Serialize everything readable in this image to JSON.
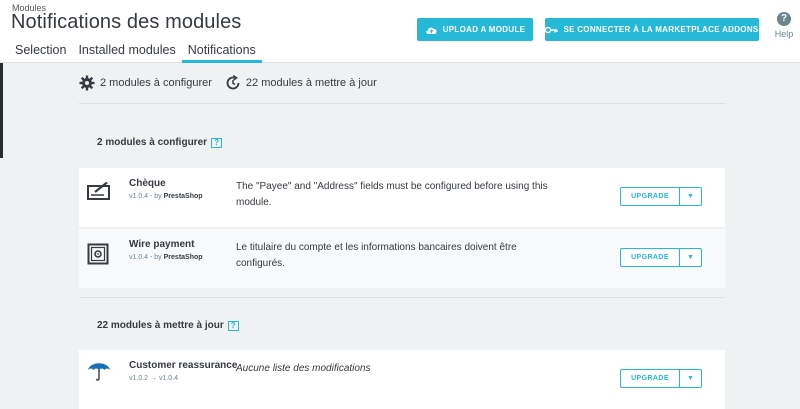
{
  "header": {
    "breadcrumb": "Modules",
    "title": "Notifications des modules",
    "upload_button": "UPLOAD A MODULE",
    "marketplace_button": "SE CONNECTER À LA MARKETPLACE ADDONS",
    "help_label": "Help",
    "help_glyph": "?"
  },
  "tabs": [
    {
      "label": "Selection",
      "active": false
    },
    {
      "label": "Installed modules",
      "active": false
    },
    {
      "label": "Notifications",
      "active": true
    }
  ],
  "summary": {
    "configure": "2 modules à configurer",
    "update": "22 modules à mettre à jour"
  },
  "sections": [
    {
      "title": "2 modules à configurer",
      "help_glyph": "?",
      "modules": [
        {
          "name": "Chèque",
          "version": "v1.0.4 - by ",
          "author": "PrestaShop",
          "description": "The \"Payee\" and \"Address\" fields must be configured before using this module.",
          "icon": "cheque-icon",
          "button": "UPGRADE"
        },
        {
          "name": "Wire payment",
          "version": "v1.0.4 - by ",
          "author": "PrestaShop",
          "description": "Le titulaire du compte et les informations bancaires doivent être configurés.",
          "icon": "safe-icon",
          "button": "UPGRADE"
        }
      ]
    },
    {
      "title": "22 modules à mettre à jour",
      "help_glyph": "?",
      "modules": [
        {
          "name": "Customer reassurance",
          "version": "v1.0.2 → v1.0.4",
          "description": "Aucune liste des modifications",
          "icon": "umbrella-icon",
          "button": "UPGRADE"
        }
      ]
    }
  ],
  "colors": {
    "accent": "#25b9d7",
    "text": "#363a41",
    "background": "#eff1f2"
  }
}
